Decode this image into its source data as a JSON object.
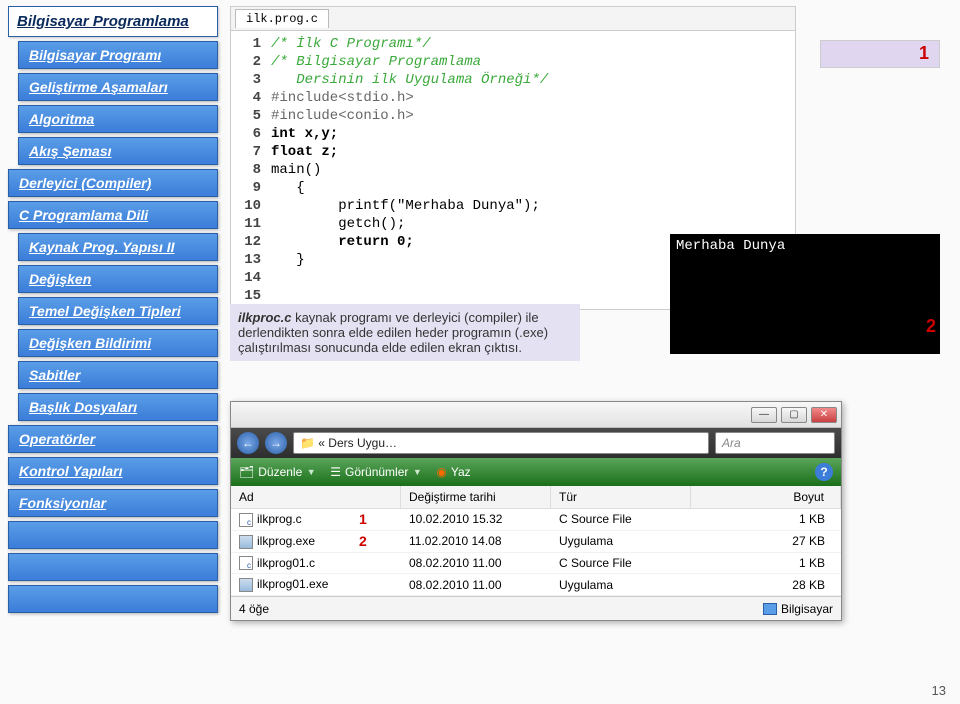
{
  "sidebar": {
    "title": "Bilgisayar Programlama",
    "items": [
      {
        "label": "Bilgisayar Programı",
        "indent": true
      },
      {
        "label": "Geliştirme Aşamaları",
        "indent": true
      },
      {
        "label": "Algoritma",
        "indent": true
      },
      {
        "label": "Akış Şeması",
        "indent": true
      },
      {
        "label": "Derleyici (Compiler)",
        "indent": false
      },
      {
        "label": "C Programlama Dili",
        "indent": false
      },
      {
        "label": "Kaynak Prog. Yapısı II",
        "indent": true
      },
      {
        "label": "Değişken",
        "indent": true
      },
      {
        "label": "Temel Değişken Tipleri",
        "indent": true
      },
      {
        "label": "Değişken Bildirimi",
        "indent": true
      },
      {
        "label": "Sabitler",
        "indent": true
      },
      {
        "label": "Başlık Dosyaları",
        "indent": true
      },
      {
        "label": "Operatörler",
        "indent": false
      },
      {
        "label": "Kontrol Yapıları",
        "indent": false
      },
      {
        "label": "Fonksiyonlar",
        "indent": false
      },
      {
        "label": "",
        "indent": false
      },
      {
        "label": "",
        "indent": false
      },
      {
        "label": "",
        "indent": false
      }
    ]
  },
  "editor": {
    "tab": "ilk.prog.c",
    "lines": [
      {
        "n": 1,
        "cls": "cmt",
        "t": "/* İlk C Programı*/"
      },
      {
        "n": 2,
        "cls": "cmt",
        "t": "/* Bilgisayar Programlama"
      },
      {
        "n": 3,
        "cls": "cmt",
        "t": "   Dersinin ilk Uygulama Örneği*/"
      },
      {
        "n": 4,
        "cls": "inc",
        "t": "#include<stdio.h>"
      },
      {
        "n": 5,
        "cls": "inc",
        "t": "#include<conio.h>"
      },
      {
        "n": 6,
        "cls": "kw",
        "t": "int x,y;"
      },
      {
        "n": 7,
        "cls": "kw",
        "t": "float z;"
      },
      {
        "n": 8,
        "cls": "",
        "t": "main()"
      },
      {
        "n": 9,
        "cls": "",
        "t": "   {"
      },
      {
        "n": 10,
        "cls": "",
        "t": "        printf(\"Merhaba Dunya\");"
      },
      {
        "n": 11,
        "cls": "",
        "t": "        getch();"
      },
      {
        "n": 12,
        "cls": "kw",
        "t": "        return 0;"
      },
      {
        "n": 13,
        "cls": "",
        "t": "   }"
      },
      {
        "n": 14,
        "cls": "",
        "t": ""
      },
      {
        "n": 15,
        "cls": "",
        "t": ""
      }
    ]
  },
  "badges": {
    "b1": "1",
    "b2": "2"
  },
  "console_output": "Merhaba Dunya",
  "caption": {
    "em": "ilkproc.c",
    "text": " kaynak programı ve derleyici (compiler) ile derlendikten sonra elde edilen heder programın (.exe) çalıştırılması sonucunda elde edilen ekran çıktısı."
  },
  "explorer": {
    "nav_back": "←",
    "nav_fwd": "→",
    "crumb_prefix": "« Ders Uygu…",
    "search_placeholder": "Ara",
    "toolbar": {
      "organize": "Düzenle",
      "views": "Görünümler",
      "burn": "Yaz"
    },
    "columns": {
      "name": "Ad",
      "date": "Değiştirme tarihi",
      "type": "Tür",
      "size": "Boyut"
    },
    "rows": [
      {
        "icon": "c",
        "name": "ilkprog.c",
        "num": "1",
        "date": "10.02.2010 15.32",
        "type": "C Source File",
        "size": "1 KB"
      },
      {
        "icon": "exe",
        "name": "ilkprog.exe",
        "num": "2",
        "date": "11.02.2010 14.08",
        "type": "Uygulama",
        "size": "27 KB"
      },
      {
        "icon": "c",
        "name": "ilkprog01.c",
        "num": "",
        "date": "08.02.2010 11.00",
        "type": "C Source File",
        "size": "1 KB"
      },
      {
        "icon": "exe",
        "name": "ilkprog01.exe",
        "num": "",
        "date": "08.02.2010 11.00",
        "type": "Uygulama",
        "size": "28 KB"
      }
    ],
    "status_left": "4 öğe",
    "status_right": "Bilgisayar"
  },
  "page_number": "13"
}
